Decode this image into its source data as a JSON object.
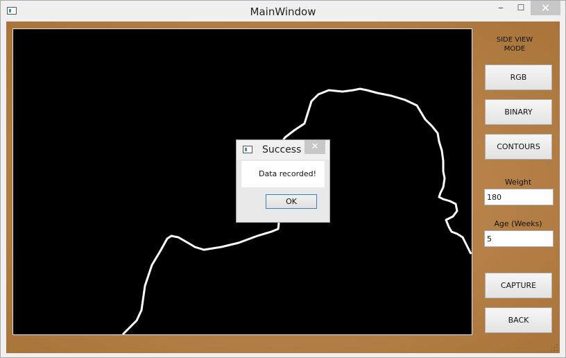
{
  "window": {
    "title": "MainWindow",
    "minimize_glyph": "‒",
    "maximize_glyph": "☐",
    "close_glyph": "✕"
  },
  "side_panel": {
    "mode_label": "SIDE VIEW\nMODE",
    "buttons": {
      "rgb": "RGB",
      "binary": "BINARY",
      "contours": "CONTOURS",
      "capture": "CAPTURE",
      "back": "BACK"
    },
    "weight_label": "Weight",
    "weight_value": "180",
    "age_label": "Age (Weeks)",
    "age_value": "5"
  },
  "dialog": {
    "title": "Success",
    "close_glyph": "✕",
    "message": "Data recorded!",
    "ok_label": "OK"
  },
  "icons": {
    "app": "window-app-icon",
    "dialog": "window-app-icon"
  }
}
